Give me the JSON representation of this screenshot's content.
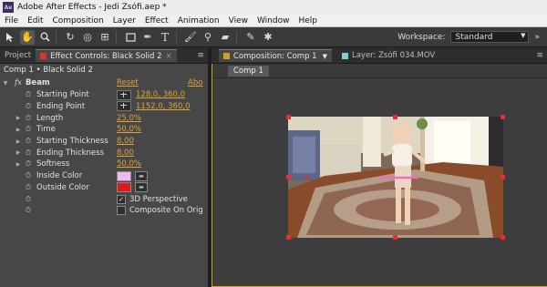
{
  "window": {
    "title": "Adobe After Effects - Jedi Zsófi.aep *",
    "app_icon": "Ae"
  },
  "menu": [
    "File",
    "Edit",
    "Composition",
    "Layer",
    "Effect",
    "Animation",
    "View",
    "Window",
    "Help"
  ],
  "toolbar": {
    "tools": [
      "selection-tool-icon",
      "hand-tool-icon",
      "zoom-tool-icon",
      "rotate-tool-icon",
      "camera-orbit-tool-icon",
      "pan-behind-tool-icon",
      "rectangle-tool-icon",
      "pen-tool-icon",
      "type-tool-icon",
      "brush-tool-icon",
      "clone-stamp-tool-icon",
      "eraser-tool-icon",
      "roto-brush-tool-icon",
      "puppet-pin-tool-icon"
    ],
    "workspace_label": "Workspace:",
    "workspace_value": "Standard"
  },
  "tabs_left": {
    "project": "Project",
    "effect_controls": "Effect Controls: Black Solid 2"
  },
  "tabs_right": {
    "composition": "Composition: Comp 1",
    "layer": "Layer: Zsófi 034.MOV"
  },
  "effect_controls": {
    "header": "Comp 1 • Black Solid 2",
    "effect": {
      "fx": "fx",
      "name": "Beam",
      "reset": "Reset",
      "about": "Abo"
    },
    "props": [
      {
        "name": "Starting Point",
        "value": "128,0, 360,0",
        "type": "point"
      },
      {
        "name": "Ending Point",
        "value": "1152,0, 360,0",
        "type": "point"
      },
      {
        "name": "Length",
        "value": "25,0%",
        "type": "value"
      },
      {
        "name": "Time",
        "value": "50,0%",
        "type": "value"
      },
      {
        "name": "Starting Thickness",
        "value": "8,00",
        "type": "value"
      },
      {
        "name": "Ending Thickness",
        "value": "8,00",
        "type": "value"
      },
      {
        "name": "Softness",
        "value": "50,0%",
        "type": "value"
      },
      {
        "name": "Inside Color",
        "value": "",
        "type": "color",
        "color": "#f4b8f0"
      },
      {
        "name": "Outside Color",
        "value": "",
        "type": "color",
        "color": "#e01818"
      },
      {
        "name": "",
        "value": "3D Perspective",
        "type": "checkbox",
        "checked": true
      },
      {
        "name": "",
        "value": "Composite On Orig",
        "type": "checkbox",
        "checked": false
      }
    ]
  },
  "composition": {
    "chip": "Comp 1"
  },
  "colors": {
    "accent": "#e0a23a",
    "panel": "#474747",
    "handle": "#e03131",
    "beam": "#f06ec0"
  }
}
